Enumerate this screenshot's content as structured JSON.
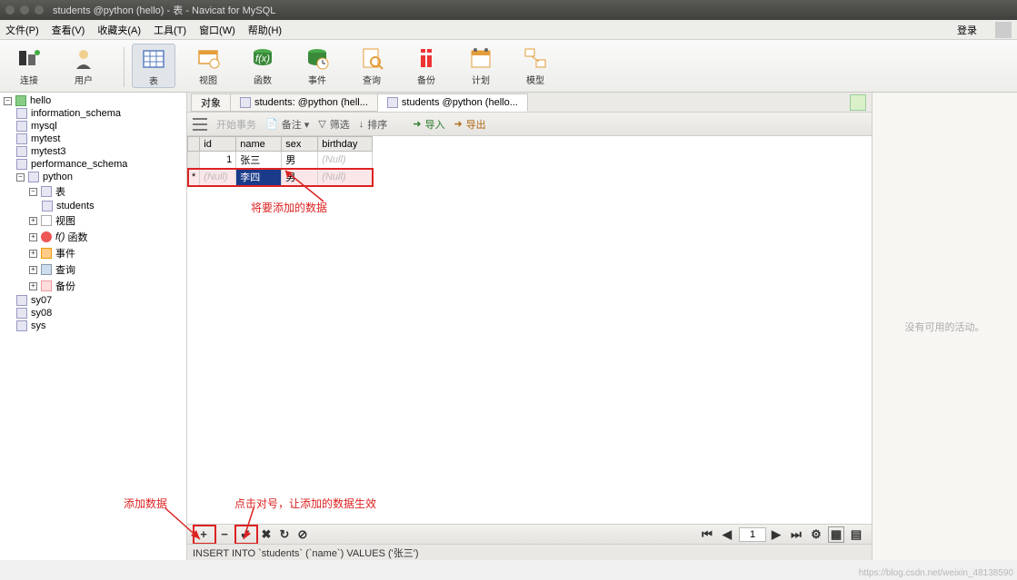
{
  "window": {
    "title": "students @python (hello) - 表 - Navicat for MySQL"
  },
  "menu": {
    "file": "文件(P)",
    "view": "查看(V)",
    "fav": "收藏夹(A)",
    "tool": "工具(T)",
    "win": "窗口(W)",
    "help": "帮助(H)",
    "login": "登录"
  },
  "toolbar": {
    "conn": "连接",
    "user": "用户",
    "table": "表",
    "viewv": "视图",
    "func": "函数",
    "event": "事件",
    "query": "查询",
    "backup": "备份",
    "plan": "计划",
    "model": "模型"
  },
  "sidebar": {
    "hello": "hello",
    "dbs": [
      "information_schema",
      "mysql",
      "mytest",
      "mytest3",
      "performance_schema"
    ],
    "python": "python",
    "tables_label": "表",
    "students": "students",
    "views": "视图",
    "funcs": "函数",
    "events": "事件",
    "queries": "查询",
    "backups": "备份",
    "extra": [
      "sy07",
      "sy08",
      "sys"
    ]
  },
  "tabs": {
    "obj": "对象",
    "t1": "students: @python (hell...",
    "t2": "students @python (hello..."
  },
  "subtb": {
    "start": "开始事务",
    "memo": "备注 ▾",
    "filter": "筛选",
    "sort": "排序",
    "import": "导入",
    "export": "导出"
  },
  "grid": {
    "cols": [
      "id",
      "name",
      "sex",
      "birthday"
    ],
    "rows": [
      {
        "id": "1",
        "name": "张三",
        "sex": "男",
        "birthday": "(Null)",
        "selected": false
      },
      {
        "id": "(Null)",
        "name": "李四",
        "sex": "男",
        "birthday": "(Null)",
        "selected": true
      }
    ]
  },
  "annot": {
    "a1": "将要添加的数据",
    "a2": "添加数据",
    "a3": "点击对号，让添加的数据生效"
  },
  "bottom": {
    "page": "1"
  },
  "status": {
    "sql": "INSERT INTO `students` (`name`) VALUES ('张三')"
  },
  "rightpanel": {
    "text": "没有可用的活动。"
  },
  "watermark": {
    "text": "https://blog.csdn.net/weixin_48138590"
  }
}
